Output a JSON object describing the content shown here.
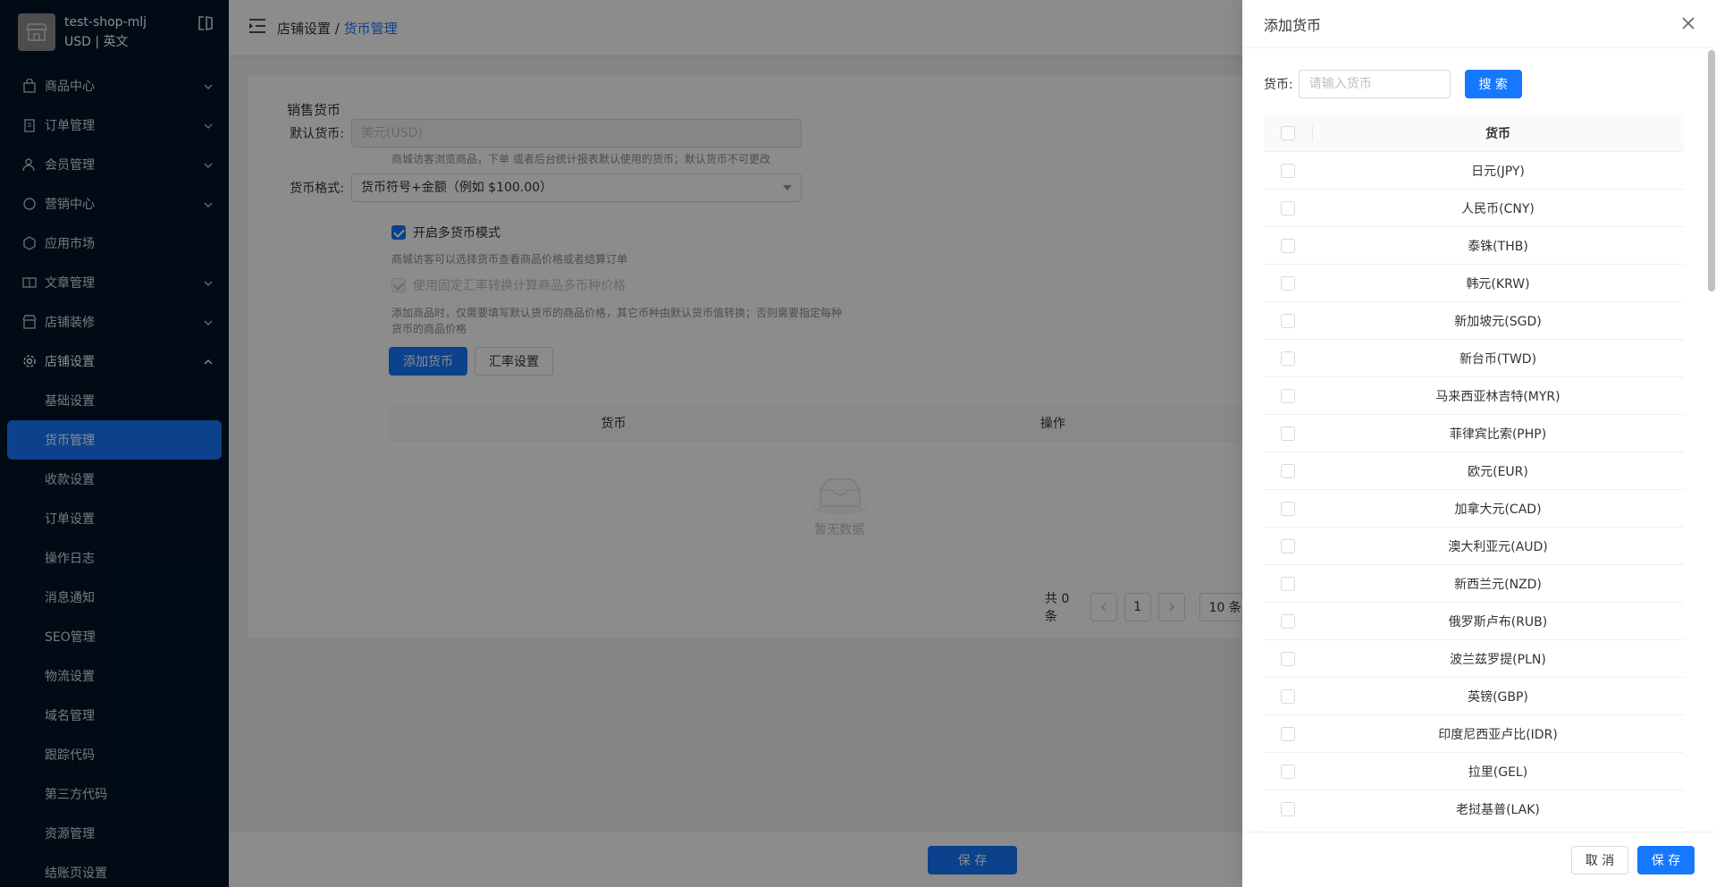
{
  "sidebar": {
    "shop_name": "test-shop-mlj",
    "shop_sub": "USD | 英文",
    "menu": [
      {
        "label": "商品中心"
      },
      {
        "label": "订单管理"
      },
      {
        "label": "会员管理"
      },
      {
        "label": "营销中心"
      },
      {
        "label": "应用市场"
      },
      {
        "label": "文章管理"
      },
      {
        "label": "店铺装修"
      },
      {
        "label": "店铺设置"
      }
    ],
    "sub_items": [
      {
        "label": "基础设置"
      },
      {
        "label": "货币管理"
      },
      {
        "label": "收款设置"
      },
      {
        "label": "订单设置"
      },
      {
        "label": "操作日志"
      },
      {
        "label": "消息通知"
      },
      {
        "label": "SEO管理"
      },
      {
        "label": "物流设置"
      },
      {
        "label": "域名管理"
      },
      {
        "label": "跟踪代码"
      },
      {
        "label": "第三方代码"
      },
      {
        "label": "资源管理"
      },
      {
        "label": "结账页设置"
      }
    ]
  },
  "header": {
    "crumb_parent": "店铺设置 / ",
    "crumb_current": "货币管理"
  },
  "main": {
    "section_title": "销售货币",
    "default_currency_label": "默认货币:",
    "default_currency_value": "美元(USD)",
    "default_currency_hint": "商城访客浏览商品，下单 或者后台统计报表默认使用的货币；默认货币不可更改",
    "format_label": "货币格式:",
    "format_value": "货币符号+金额（例如 $100.00）",
    "multi_currency_label": "开启多货币模式",
    "multi_currency_hint": "商城访客可以选择货币查看商品价格或者结算订单",
    "fixed_rate_label": "使用固定汇率转换计算商品多币种价格",
    "fixed_rate_hint_1": "添加商品时，仅需要填写默认货币的商品价格，其它币种由默认货币值转换；否则需要指定每种",
    "fixed_rate_hint_2": "货币的商品价格",
    "add_currency_btn": "添加货币",
    "rate_setting_btn": "汇率设置",
    "table_col_currency": "货币",
    "table_col_action": "操作",
    "empty_text": "暂无数据",
    "total_text": "共 0 条",
    "page_num": "1",
    "page_size": "10 条",
    "save_btn": "保 存"
  },
  "drawer": {
    "title": "添加货币",
    "search_label": "货币:",
    "search_placeholder": "请输入货币",
    "search_btn": "搜 索",
    "col_currency": "货币",
    "rows": [
      "日元(JPY)",
      "人民币(CNY)",
      "泰铢(THB)",
      "韩元(KRW)",
      "新加坡元(SGD)",
      "新台币(TWD)",
      "马来西亚林吉特(MYR)",
      "菲律宾比索(PHP)",
      "欧元(EUR)",
      "加拿大元(CAD)",
      "澳大利亚元(AUD)",
      "新西兰元(NZD)",
      "俄罗斯卢布(RUB)",
      "波兰兹罗提(PLN)",
      "英镑(GBP)",
      "印度尼西亚卢比(IDR)",
      "拉里(GEL)",
      "老挝基普(LAK)"
    ],
    "cancel_btn": "取 消",
    "save_btn": "保 存"
  },
  "colors": {
    "primary": "#1677ff",
    "sidebar_bg": "#001529"
  }
}
